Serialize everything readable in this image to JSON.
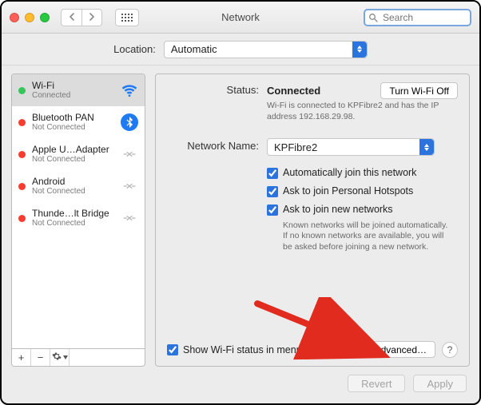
{
  "window_title": "Network",
  "search_placeholder": "Search",
  "location": {
    "label": "Location:",
    "value": "Automatic"
  },
  "services": [
    {
      "name": "Wi-Fi",
      "sub": "Connected",
      "status": "green",
      "icon": "wifi",
      "selected": true
    },
    {
      "name": "Bluetooth PAN",
      "sub": "Not Connected",
      "status": "red",
      "icon": "bluetooth",
      "selected": false
    },
    {
      "name": "Apple U…Adapter",
      "sub": "Not Connected",
      "status": "red",
      "icon": "link",
      "selected": false
    },
    {
      "name": "Android",
      "sub": "Not Connected",
      "status": "red",
      "icon": "link",
      "selected": false
    },
    {
      "name": "Thunde…lt Bridge",
      "sub": "Not Connected",
      "status": "red",
      "icon": "link",
      "selected": false
    }
  ],
  "status": {
    "label": "Status:",
    "value": "Connected",
    "turn_off_label": "Turn Wi-Fi Off",
    "description": "Wi-Fi is connected to KPFibre2 and has the IP address 192.168.29.98."
  },
  "network_name": {
    "label": "Network Name:",
    "value": "KPFibre2"
  },
  "options": {
    "auto_join": {
      "checked": true,
      "label": "Automatically join this network"
    },
    "personal_hotspots": {
      "checked": true,
      "label": "Ask to join Personal Hotspots"
    },
    "ask_new": {
      "checked": true,
      "label": "Ask to join new networks"
    },
    "ask_new_desc": "Known networks will be joined automatically. If no known networks are available, you will be asked before joining a new network."
  },
  "menubar": {
    "checked": true,
    "label": "Show Wi-Fi status in menu bar"
  },
  "advanced_label": "Advanced…",
  "help_label": "?",
  "footer": {
    "revert": "Revert",
    "apply": "Apply"
  }
}
